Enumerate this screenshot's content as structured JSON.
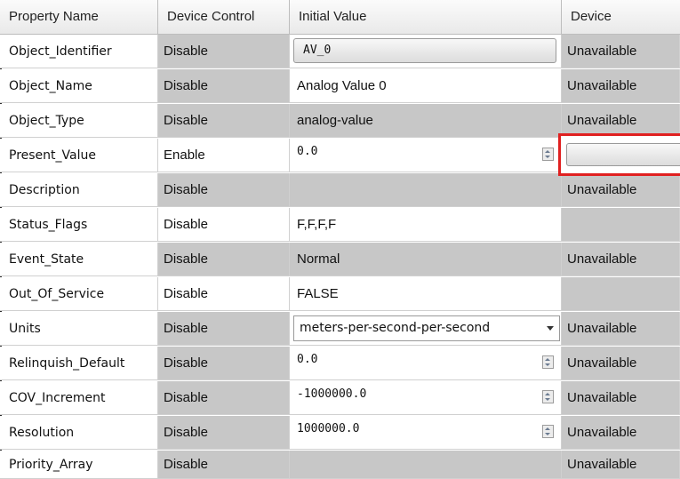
{
  "headers": [
    "Property Name",
    "Device Control",
    "Initial Value",
    "Device"
  ],
  "rows": [
    {
      "name": "Object_Identifier",
      "control": "Disable",
      "value": "AV_0",
      "device": "Unavailable"
    },
    {
      "name": "Object_Name",
      "control": "Disable",
      "value": "Analog Value 0",
      "device": "Unavailable"
    },
    {
      "name": "Object_Type",
      "control": "Disable",
      "value": "analog-value",
      "device": "Unavailable"
    },
    {
      "name": "Present_Value",
      "control": "Enable",
      "value": "0.0",
      "device": ""
    },
    {
      "name": "Description",
      "control": "Disable",
      "value": "",
      "device": "Unavailable"
    },
    {
      "name": "Status_Flags",
      "control": "Disable",
      "value": "F,F,F,F",
      "device": ""
    },
    {
      "name": "Event_State",
      "control": "Disable",
      "value": "Normal",
      "device": "Unavailable"
    },
    {
      "name": "Out_Of_Service",
      "control": "Disable",
      "value": "FALSE",
      "device": ""
    },
    {
      "name": "Units",
      "control": "Disable",
      "value": "meters-per-second-per-second",
      "device": "Unavailable"
    },
    {
      "name": "Relinquish_Default",
      "control": "Disable",
      "value": "0.0",
      "device": "Unavailable"
    },
    {
      "name": "COV_Increment",
      "control": "Disable",
      "value": "-1000000.0",
      "device": "Unavailable"
    },
    {
      "name": "Resolution",
      "control": "Disable",
      "value": "1000000.0",
      "device": "Unavailable"
    },
    {
      "name": "Priority_Array",
      "control": "Disable",
      "value": "",
      "device": "Unavailable"
    }
  ],
  "colors": {
    "gray_cell": "#c7c7c7",
    "highlight": "#e02020"
  }
}
